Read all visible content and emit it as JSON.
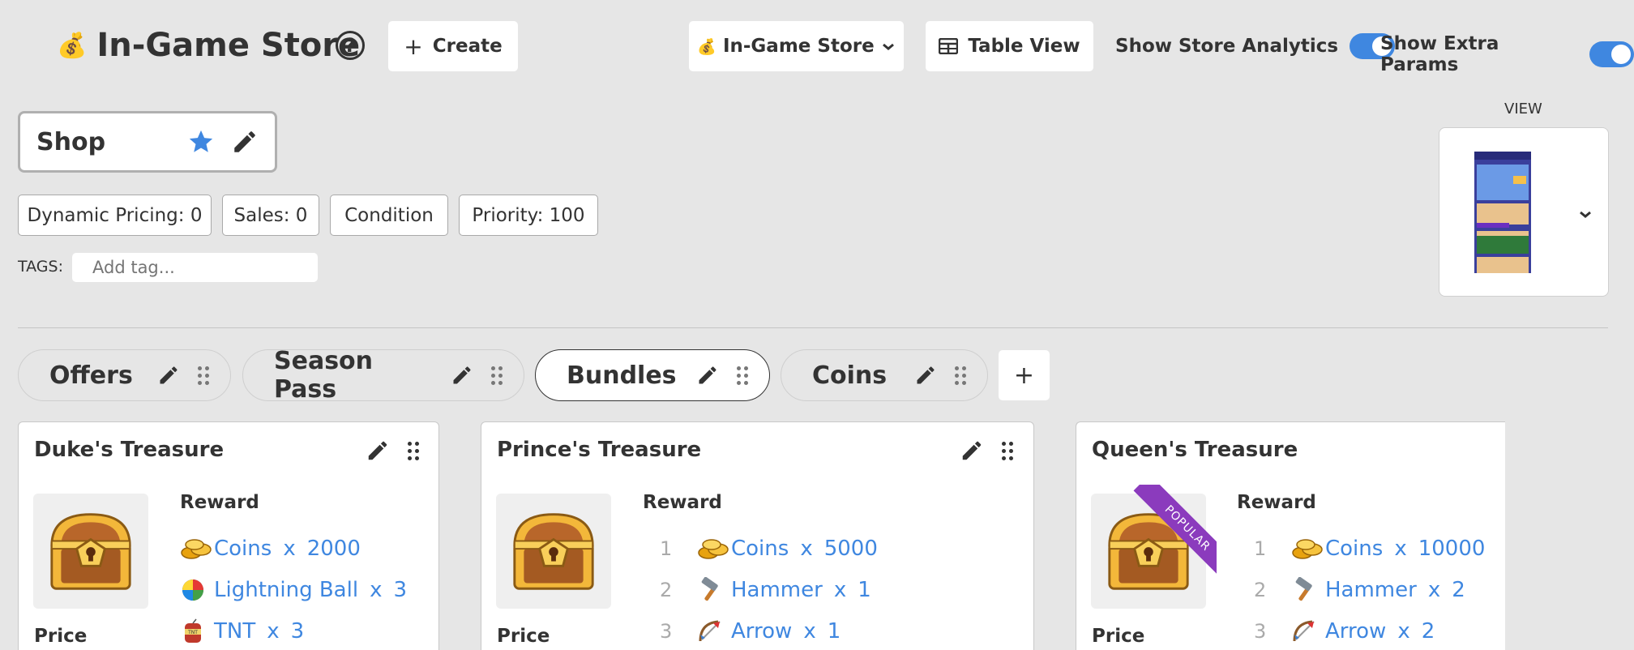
{
  "header": {
    "title": "In-Game Store",
    "help": "?",
    "create_label": "Create",
    "store_select": "In-Game Store",
    "table_view_label": "Table View",
    "show_analytics_label": "Show Store Analytics",
    "show_extra_params_label": "Show Extra Params",
    "show_analytics_on": true,
    "show_extra_params_on": true
  },
  "shop": {
    "name": "Shop",
    "dynamic_pricing": "Dynamic Pricing: 0",
    "sales": "Sales: 0",
    "condition": "Condition",
    "priority": "Priority: 100",
    "tags_label": "TAGS:",
    "tag_placeholder": "Add tag..."
  },
  "view": {
    "label": "VIEW"
  },
  "tabs": [
    {
      "label": "Offers"
    },
    {
      "label": "Season Pass"
    },
    {
      "label": "Bundles",
      "active": true
    },
    {
      "label": "Coins"
    }
  ],
  "add_tab": "+",
  "items": [
    {
      "name": "Duke's Treasure",
      "reward_label": "Reward",
      "price_label": "Price",
      "rewards": [
        {
          "name": "Coins",
          "x": "x",
          "qty": "2000",
          "icon": "coins-icon"
        },
        {
          "name": "Lightning Ball",
          "x": "x",
          "qty": "3",
          "icon": "lightning-ball-icon"
        },
        {
          "name": "TNT",
          "x": "x",
          "qty": "3",
          "icon": "tnt-icon"
        }
      ]
    },
    {
      "name": "Prince's Treasure",
      "reward_label": "Reward",
      "price_label": "Price",
      "rewards": [
        {
          "num": "1",
          "name": "Coins",
          "x": "x",
          "qty": "5000",
          "icon": "coins-icon"
        },
        {
          "num": "2",
          "name": "Hammer",
          "x": "x",
          "qty": "1",
          "icon": "hammer-icon"
        },
        {
          "num": "3",
          "name": "Arrow",
          "x": "x",
          "qty": "1",
          "icon": "arrow-icon"
        }
      ]
    },
    {
      "name": "Queen's Treasure",
      "reward_label": "Reward",
      "price_label": "Price",
      "badge": "POPULAR",
      "rewards": [
        {
          "num": "1",
          "name": "Coins",
          "x": "x",
          "qty": "10000",
          "icon": "coins-icon"
        },
        {
          "num": "2",
          "name": "Hammer",
          "x": "x",
          "qty": "2",
          "icon": "hammer-icon"
        },
        {
          "num": "3",
          "name": "Arrow",
          "x": "x",
          "qty": "2",
          "icon": "arrow-icon"
        }
      ]
    }
  ],
  "colors": {
    "accent": "#3f87e0",
    "background": "#e6e6e6",
    "ribbon": "#8b3bbd"
  }
}
